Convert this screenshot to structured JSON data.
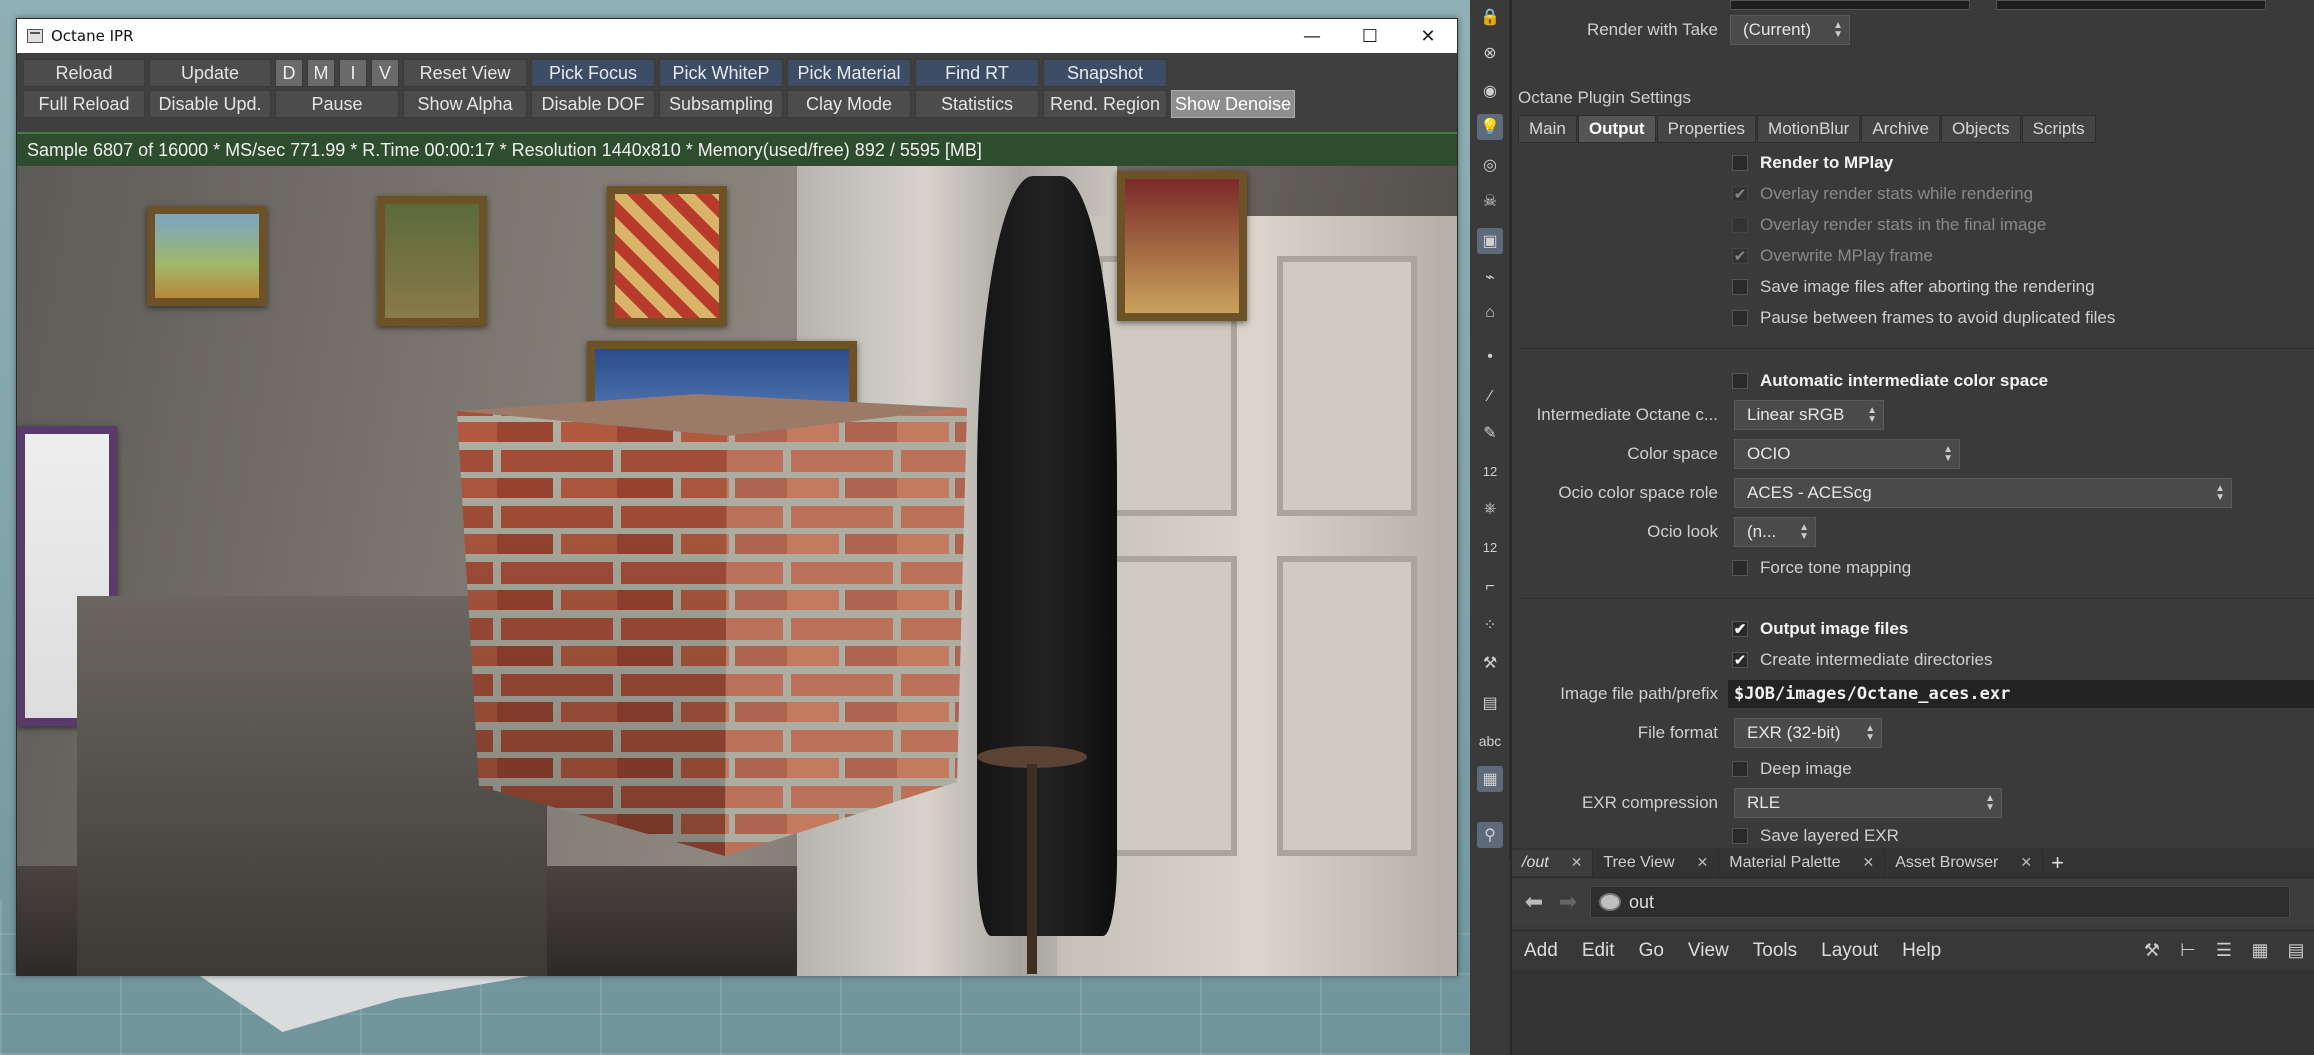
{
  "window": {
    "title": "Octane IPR",
    "minimize": "—",
    "maximize": "☐",
    "close": "✕"
  },
  "toolbar": {
    "row1": [
      {
        "id": "reload",
        "label": "Reload",
        "style": "normal",
        "w": 122
      },
      {
        "id": "update",
        "label": "Update",
        "style": "normal",
        "w": 122
      },
      {
        "id": "d",
        "label": "D",
        "style": "mini",
        "w": 28
      },
      {
        "id": "m",
        "label": "M",
        "style": "mini",
        "w": 28
      },
      {
        "id": "i",
        "label": "I",
        "style": "mini",
        "w": 28
      },
      {
        "id": "v",
        "label": "V",
        "style": "mini",
        "w": 28
      },
      {
        "id": "reset-view",
        "label": "Reset View",
        "style": "normal",
        "w": 124
      },
      {
        "id": "pick-focus",
        "label": "Pick Focus",
        "style": "blue",
        "w": 124
      },
      {
        "id": "pick-whitep",
        "label": "Pick WhiteP",
        "style": "blue",
        "w": 124
      },
      {
        "id": "pick-material",
        "label": "Pick Material",
        "style": "blue",
        "w": 124
      },
      {
        "id": "find-rt",
        "label": "Find RT",
        "style": "blue",
        "w": 124
      },
      {
        "id": "snapshot",
        "label": "Snapshot",
        "style": "blue",
        "w": 124
      }
    ],
    "row2": [
      {
        "id": "full-reload",
        "label": "Full Reload",
        "style": "normal",
        "w": 122
      },
      {
        "id": "disable-upd",
        "label": "Disable Upd.",
        "style": "normal",
        "w": 122
      },
      {
        "id": "pause",
        "label": "Pause",
        "style": "normal",
        "w": 124
      },
      {
        "id": "show-alpha",
        "label": "Show Alpha",
        "style": "normal",
        "w": 124
      },
      {
        "id": "disable-dof",
        "label": "Disable DOF",
        "style": "normal",
        "w": 124
      },
      {
        "id": "subsampling",
        "label": "Subsampling",
        "style": "normal",
        "w": 124
      },
      {
        "id": "clay-mode",
        "label": "Clay Mode",
        "style": "normal",
        "w": 124
      },
      {
        "id": "statistics",
        "label": "Statistics",
        "style": "normal",
        "w": 124
      },
      {
        "id": "rend-region",
        "label": "Rend. Region",
        "style": "normal",
        "w": 124
      },
      {
        "id": "show-denoise",
        "label": "Show Denoise",
        "style": "active",
        "w": 124
      }
    ]
  },
  "status": "Sample 6807 of 16000 * MS/sec 771.99 * R.Time 00:00:17 * Resolution 1440x810 * Memory(used/free) 892 / 5595 [MB]",
  "panel": {
    "render_with_take_label": "Render with Take",
    "render_with_take_value": "(Current)",
    "section_title": "Octane Plugin Settings",
    "tabs": [
      {
        "label": "Main",
        "selected": false
      },
      {
        "label": "Output",
        "selected": true
      },
      {
        "label": "Properties",
        "selected": false
      },
      {
        "label": "MotionBlur",
        "selected": false
      },
      {
        "label": "Archive",
        "selected": false
      },
      {
        "label": "Objects",
        "selected": false
      },
      {
        "label": "Scripts",
        "selected": false
      }
    ],
    "checkboxes": [
      {
        "label": "Render to MPlay",
        "checked": false,
        "bold": true,
        "dim": false
      },
      {
        "label": "Overlay render stats while rendering",
        "checked": true,
        "bold": false,
        "dim": true
      },
      {
        "label": "Overlay render stats in the final image",
        "checked": false,
        "bold": false,
        "dim": true
      },
      {
        "label": "Overwrite MPlay frame",
        "checked": true,
        "bold": false,
        "dim": true
      },
      {
        "label": "Save image files after aborting the rendering",
        "checked": false,
        "bold": false,
        "dim": false
      },
      {
        "label": "Pause between frames to avoid duplicated files",
        "checked": false,
        "bold": false,
        "dim": false
      }
    ],
    "auto_color_space": {
      "label": "Automatic intermediate color space",
      "checked": false
    },
    "intermediate_label": "Intermediate Octane c...",
    "intermediate_value": "Linear sRGB",
    "color_space_label": "Color space",
    "color_space_value": "OCIO",
    "ocio_role_label": "Ocio color space role",
    "ocio_role_value": "ACES - ACEScg",
    "ocio_look_label": "Ocio look",
    "ocio_look_value": "(n...",
    "force_tone": {
      "label": "Force tone mapping",
      "checked": false
    },
    "output_image_files": {
      "label": "Output image files",
      "checked": true
    },
    "create_dirs": {
      "label": "Create intermediate directories",
      "checked": true
    },
    "image_path_label": "Image file path/prefix",
    "image_path_value": "$JOB/images/Octane_aces.exr",
    "file_format_label": "File format",
    "file_format_value": "EXR (32-bit)",
    "deep_image": {
      "label": "Deep image",
      "checked": false
    },
    "exr_comp_label": "EXR compression",
    "exr_comp_value": "RLE",
    "cut_label": "Save layered EXR"
  },
  "pane_tabs": [
    {
      "label": "/out",
      "selected": true
    },
    {
      "label": "Tree View",
      "selected": false
    },
    {
      "label": "Material Palette",
      "selected": false
    },
    {
      "label": "Asset Browser",
      "selected": false
    }
  ],
  "pane_add": "+",
  "path_value": "out",
  "menus": [
    "Add",
    "Edit",
    "Go",
    "View",
    "Tools",
    "Layout",
    "Help"
  ],
  "shelf_labels": {
    "twelve_a": "12",
    "twelve_b": "12",
    "abc": "abc"
  },
  "colors": {
    "status_green": "#2e4d2e",
    "button_blue": "#3d4d66",
    "selected_tab": "#555555"
  }
}
